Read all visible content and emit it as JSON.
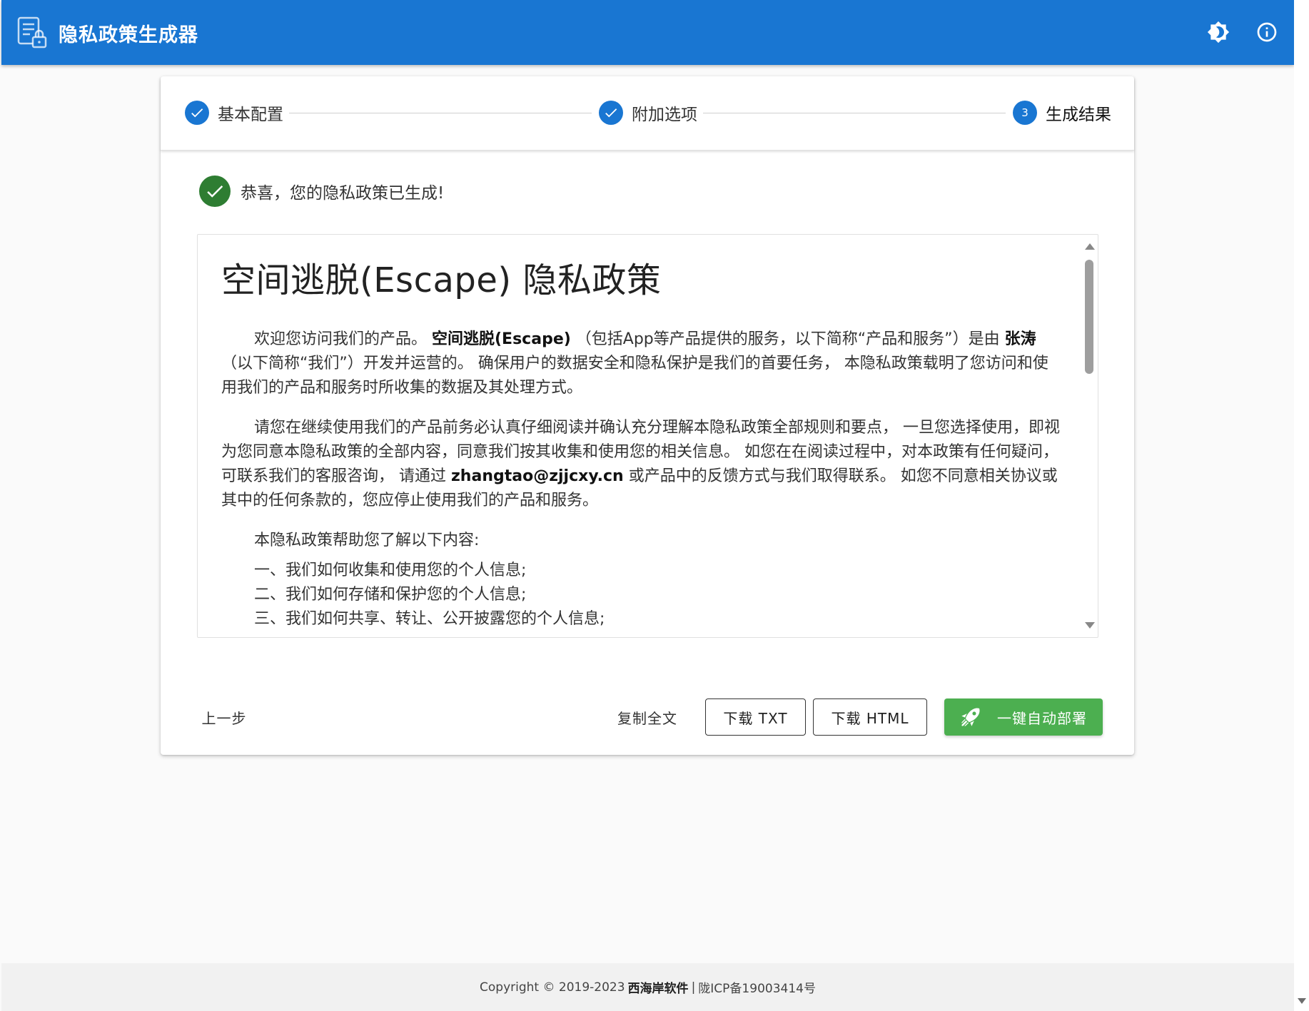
{
  "app": {
    "title": "隐私政策生成器"
  },
  "stepper": {
    "steps": [
      {
        "label": "基本配置",
        "state": "complete"
      },
      {
        "label": "附加选项",
        "state": "complete"
      },
      {
        "label": "生成结果",
        "number": "3",
        "state": "active"
      }
    ]
  },
  "result": {
    "success_message": "恭喜，您的隐私政策已生成!"
  },
  "document": {
    "title": "空间逃脱(Escape) 隐私政策",
    "p1": {
      "a": "欢迎您访问我们的产品。 ",
      "product": "空间逃脱(Escape)",
      "b": " （包括App等产品提供的服务，以下简称“产品和服务”）是由 ",
      "company": "张涛",
      "c": " （以下简称“我们”）开发并运营的。 确保用户的数据安全和隐私保护是我们的首要任务， 本隐私政策载明了您访问和使用我们的产品和服务时所收集的数据及其处理方式。"
    },
    "p2": {
      "a": "请您在继续使用我们的产品前务必认真仔细阅读并确认充分理解本隐私政策全部规则和要点， 一旦您选择使用，即视为您同意本隐私政策的全部内容，同意我们按其收集和使用您的相关信息。 如您在在阅读过程中，对本政策有任何疑问，可联系我们的客服咨询， 请通过 ",
      "email": "zhangtao@zjjcxy.cn",
      "b": " 或产品中的反馈方式与我们取得联系。 如您不同意相关协议或其中的任何条款的，您应停止使用我们的产品和服务。"
    },
    "p3": "本隐私政策帮助您了解以下内容:",
    "toc": [
      "一、我们如何收集和使用您的个人信息;",
      "二、我们如何存储和保护您的个人信息;",
      "三、我们如何共享、转让、公开披露您的个人信息;"
    ]
  },
  "actions": {
    "back": "上一步",
    "copy": "复制全文",
    "download_txt": "下载 TXT",
    "download_html": "下载 HTML",
    "deploy": "一键自动部署"
  },
  "footer": {
    "copyright": "Copyright © 2019-2023",
    "company": "西海岸软件",
    "separator": "|",
    "icp": "陇ICP备19003414号"
  },
  "colors": {
    "primary": "#1976d2",
    "success": "#2e7d32",
    "deploy": "#4caf50"
  }
}
